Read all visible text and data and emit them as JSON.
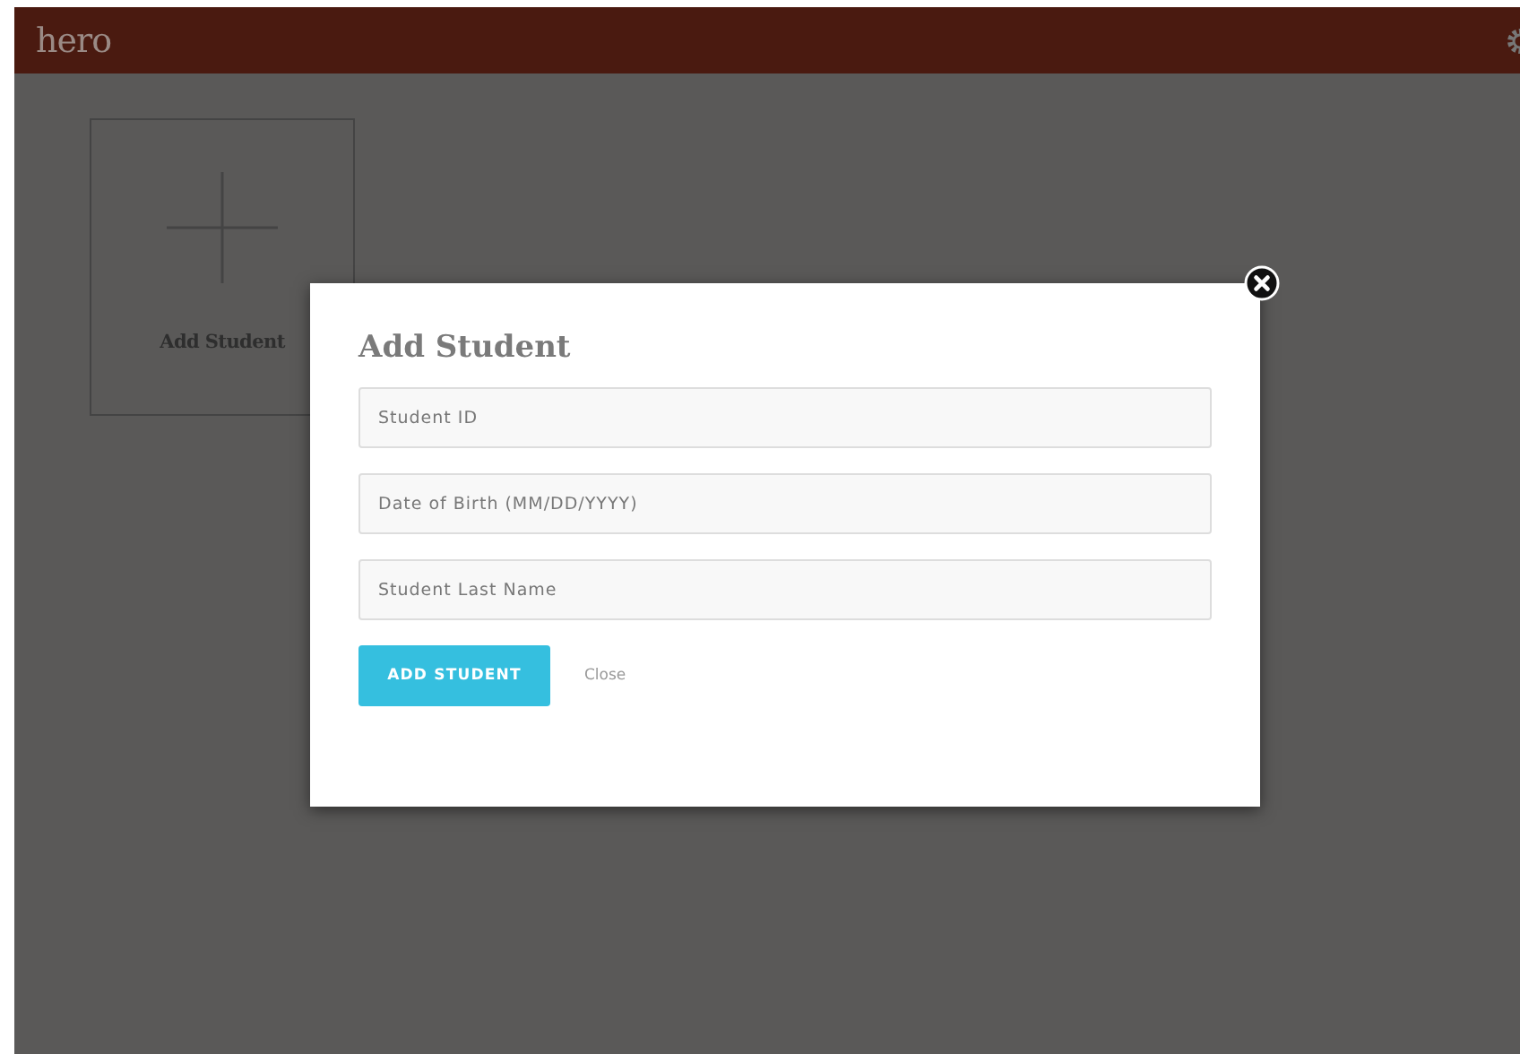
{
  "header": {
    "logo": "hero"
  },
  "card": {
    "label": "Add Student"
  },
  "modal": {
    "title": "Add Student",
    "fields": [
      {
        "placeholder": "Student ID"
      },
      {
        "placeholder": "Date of Birth (MM/DD/YYYY)"
      },
      {
        "placeholder": "Student Last Name"
      }
    ],
    "submit": "ADD STUDENT",
    "close": "Close"
  }
}
